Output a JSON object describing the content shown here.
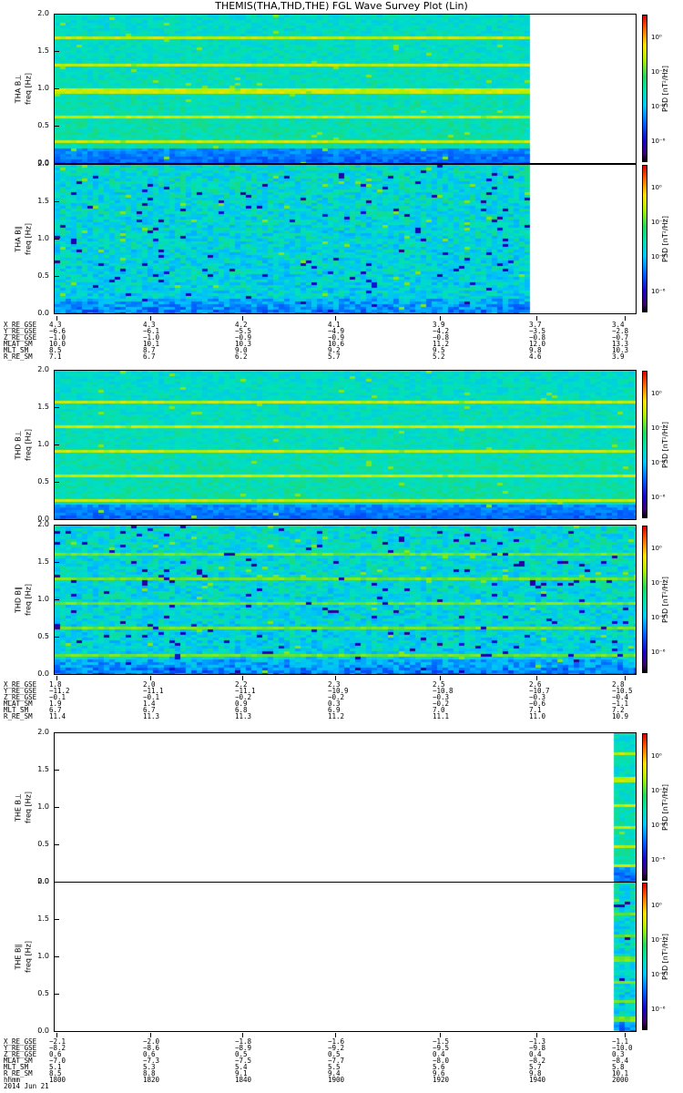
{
  "title": "THEMIS(THA,THD,THE) FGL Wave Survey Plot (Lin)",
  "panels": [
    {
      "probe": "THA",
      "comp": "B⊥",
      "ylabel1": "THA B⊥",
      "ylabel2": "freq [Hz]",
      "data_end": 0.81,
      "data_start": 0.0,
      "lines": [
        0.33,
        0.67,
        1.0,
        1.35,
        1.7
      ]
    },
    {
      "probe": "THA",
      "comp": "B∥",
      "ylabel1": "THA B∥",
      "ylabel2": "freq [Hz]",
      "data_end": 0.81,
      "data_start": 0.0,
      "lines": []
    },
    {
      "probe": "THD",
      "comp": "B⊥",
      "ylabel1": "THD B⊥",
      "ylabel2": "freq [Hz]",
      "data_end": 1.0,
      "data_start": 0.0,
      "lines": [
        0.3,
        0.62,
        0.95,
        1.28,
        1.6
      ]
    },
    {
      "probe": "THD",
      "comp": "B∥",
      "ylabel1": "THD B∥",
      "ylabel2": "freq [Hz]",
      "data_end": 1.0,
      "data_start": 0.0,
      "lines": [
        0.3,
        0.65,
        0.97,
        1.3,
        1.62
      ]
    },
    {
      "probe": "THE",
      "comp": "B⊥",
      "ylabel1": "THE B⊥",
      "ylabel2": "freq [Hz]",
      "data_end": 1.0,
      "data_start": 0.96,
      "lines": [
        0.25,
        0.5,
        0.75,
        1.05,
        1.4,
        1.75
      ]
    },
    {
      "probe": "THE",
      "comp": "B∥",
      "ylabel1": "THE B∥",
      "ylabel2": "freq [Hz]",
      "data_end": 1.0,
      "data_start": 0.96,
      "lines": [
        0.2,
        0.45,
        0.7,
        1.0,
        1.3,
        1.6
      ]
    }
  ],
  "yticks": [
    "0.0",
    "0.5",
    "1.0",
    "1.5",
    "2.0"
  ],
  "colorbar": {
    "label": "PSD [nT²/Hz]",
    "ticks": [
      "10⁰",
      "10⁻²",
      "10⁻⁴",
      "10⁻⁶"
    ]
  },
  "ephem_labels_1": [
    "X_RE_GSE",
    "Y_RE_GSE",
    "Z_RE_GSE",
    "MLAT_SM",
    "MLT_SM",
    "R_RE_SM"
  ],
  "ephem_labels_3": [
    "X_RE_GSE",
    "Y_RE_GSE",
    "Z_RE_GSE",
    "MLAT_SM",
    "MLT_SM",
    "R_RE_SM",
    "hhmm",
    "2014 Jun 21"
  ],
  "ephem_THA": [
    [
      "4.3",
      "4.3",
      "4.2",
      "4.1",
      "3.9",
      "3.7",
      "3.4"
    ],
    [
      "−6.6",
      "−6.1",
      "−5.5",
      "−4.9",
      "−4.2",
      "−3.5",
      "−2.8"
    ],
    [
      "−1.0",
      "−1.0",
      "−0.9",
      "−0.9",
      "−0.8",
      "−0.8",
      "−0.7"
    ],
    [
      "10.0",
      "10.1",
      "10.3",
      "10.6",
      "11.2",
      "12.0",
      "13.3"
    ],
    [
      "8.5",
      "8.7",
      "9.0",
      "9.2",
      "9.5",
      "9.8",
      "10.3"
    ],
    [
      "7.1",
      "6.7",
      "6.2",
      "5.7",
      "5.2",
      "4.6",
      "3.9"
    ]
  ],
  "ephem_THD": [
    [
      "1.8",
      "2.0",
      "2.2",
      "2.3",
      "2.5",
      "2.6",
      "2.8"
    ],
    [
      "−11.2",
      "−11.1",
      "−11.1",
      "−10.9",
      "−10.8",
      "−10.7",
      "−10.5"
    ],
    [
      "−0.1",
      "−0.1",
      "−0.2",
      "−0.2",
      "−0.3",
      "−0.3",
      "−0.4"
    ],
    [
      "1.9",
      "1.4",
      "0.9",
      "0.3",
      "−0.2",
      "−0.6",
      "−1.1"
    ],
    [
      "6.7",
      "6.7",
      "6.8",
      "6.9",
      "7.0",
      "7.1",
      "7.2"
    ],
    [
      "11.4",
      "11.3",
      "11.3",
      "11.2",
      "11.1",
      "11.0",
      "10.9"
    ]
  ],
  "ephem_THE": [
    [
      "−2.1",
      "−2.0",
      "−1.8",
      "−1.6",
      "−1.5",
      "−1.3",
      "−1.1"
    ],
    [
      "−8.2",
      "−8.6",
      "−8.9",
      "−9.2",
      "−9.5",
      "−9.8",
      "−10.0"
    ],
    [
      "0.6",
      "0.6",
      "0.5",
      "0.5",
      "0.4",
      "0.4",
      "0.3"
    ],
    [
      "−7.0",
      "−7.3",
      "−7.5",
      "−7.7",
      "−8.0",
      "−8.2",
      "−8.4"
    ],
    [
      "5.1",
      "5.3",
      "5.4",
      "5.5",
      "5.6",
      "5.7",
      "5.8"
    ],
    [
      "8.5",
      "8.8",
      "9.1",
      "9.4",
      "9.6",
      "9.8",
      "10.1"
    ],
    [
      "1800",
      "1820",
      "1840",
      "1900",
      "1920",
      "1940",
      "2000"
    ]
  ],
  "chart_data": [
    {
      "type": "heatmap",
      "title": "THEMIS(THA,THD,THE) FGL Wave Survey Plot (Lin)",
      "ylabel": "THA B⊥ freq [Hz]",
      "ylim": [
        0,
        2
      ],
      "colorbar_label": "PSD [nT²/Hz]",
      "x": [
        "1800",
        "1820",
        "1840",
        "1900",
        "1920",
        "1940",
        "2000"
      ],
      "spectral_lines_hz": [
        0.33,
        0.67,
        1.0,
        1.35,
        1.7
      ]
    },
    {
      "type": "heatmap",
      "ylabel": "THA B∥ freq [Hz]",
      "ylim": [
        0,
        2
      ],
      "colorbar_label": "PSD [nT²/Hz]"
    },
    {
      "type": "heatmap",
      "ylabel": "THD B⊥ freq [Hz]",
      "ylim": [
        0,
        2
      ],
      "colorbar_label": "PSD [nT²/Hz]",
      "spectral_lines_hz": [
        0.3,
        0.62,
        0.95,
        1.28,
        1.6
      ]
    },
    {
      "type": "heatmap",
      "ylabel": "THD B∥ freq [Hz]",
      "ylim": [
        0,
        2
      ],
      "colorbar_label": "PSD [nT²/Hz]"
    },
    {
      "type": "heatmap",
      "ylabel": "THE B⊥ freq [Hz]",
      "ylim": [
        0,
        2
      ],
      "colorbar_label": "PSD [nT²/Hz]"
    },
    {
      "type": "heatmap",
      "ylabel": "THE B∥ freq [Hz]",
      "ylim": [
        0,
        2
      ],
      "colorbar_label": "PSD [nT²/Hz]"
    }
  ]
}
